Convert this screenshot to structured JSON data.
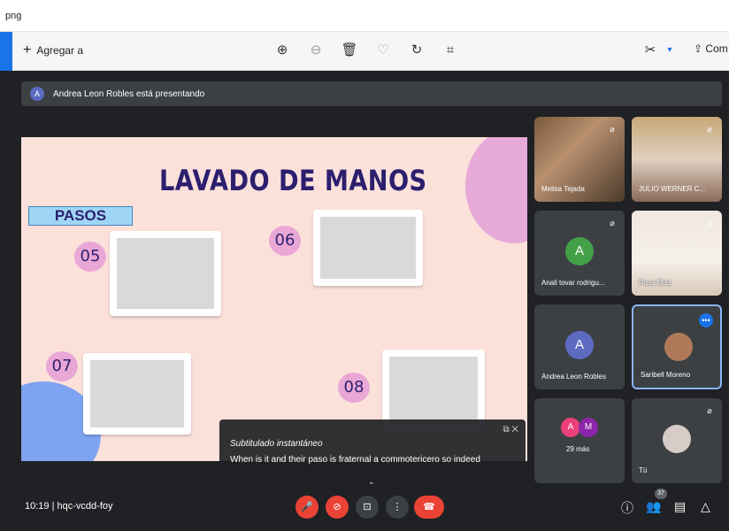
{
  "window": {
    "title": "png"
  },
  "toolbar": {
    "add_label": "Agregar a",
    "share_label": "Com"
  },
  "banner": {
    "avatar_letter": "A",
    "text": "Andrea Leon Robles está presentando"
  },
  "slide": {
    "title": "LAVADO DE MANOS",
    "pasos": "PASOS",
    "steps": [
      "05",
      "06",
      "07",
      "08"
    ]
  },
  "participants": [
    {
      "name": "Melisa Tejada",
      "type": "video"
    },
    {
      "name": "JULIO WERNER C...",
      "type": "video"
    },
    {
      "name": "Anali tovar rodrigu...",
      "type": "avatar",
      "letter": "A",
      "color": "#43a047"
    },
    {
      "name": "Rosa Diaz",
      "type": "video"
    },
    {
      "name": "Andrea Leon Robles",
      "type": "avatar",
      "letter": "A",
      "color": "#5c6bc0"
    },
    {
      "name": "Saribell Moreno",
      "type": "avatar-photo"
    },
    {
      "more_count": "29 más",
      "letters": [
        "A",
        "M"
      ]
    },
    {
      "name": "Tú",
      "type": "avatar-photo"
    }
  ],
  "caption": {
    "header": "Subtitulado instantáneo",
    "text": "When is it and their paso is fraternal a commotericero so indeed"
  },
  "bottom": {
    "time": "10:19",
    "separator": "|",
    "code": "hqc-vcdd-foy",
    "participants_badge": "37"
  },
  "colors": {
    "accent": "#1a73e8",
    "danger": "#ea4335",
    "meet_bg": "#202124",
    "tile_bg": "#3c4043",
    "slide_bg": "#fbe1da",
    "slide_title": "#2c1f6e"
  }
}
